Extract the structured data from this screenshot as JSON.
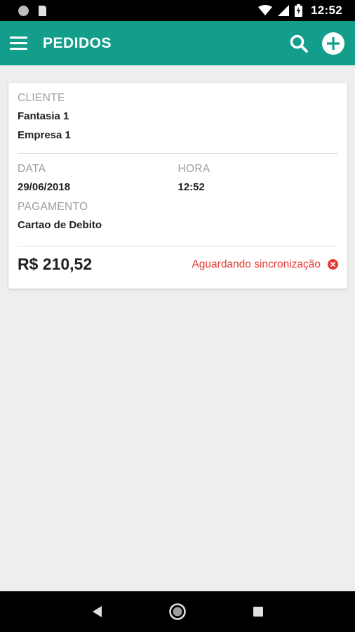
{
  "status_bar": {
    "time": "12:52"
  },
  "app_bar": {
    "title": "PEDIDOS"
  },
  "order": {
    "cliente_label": "CLIENTE",
    "fantasia": "Fantasia 1",
    "empresa": "Empresa 1",
    "data_label": "DATA",
    "data_value": "29/06/2018",
    "hora_label": "HORA",
    "hora_value": "12:52",
    "pagamento_label": "PAGAMENTO",
    "pagamento_value": "Cartao de Debito",
    "total": "R$ 210,52",
    "status": "Aguardando sincronização"
  },
  "colors": {
    "primary": "#129e8a",
    "error": "#e53935",
    "background": "#eeeeee"
  },
  "icons": [
    "menu-icon",
    "search-icon",
    "add-icon",
    "sync-error-icon",
    "back-icon",
    "home-icon",
    "recents-icon"
  ]
}
